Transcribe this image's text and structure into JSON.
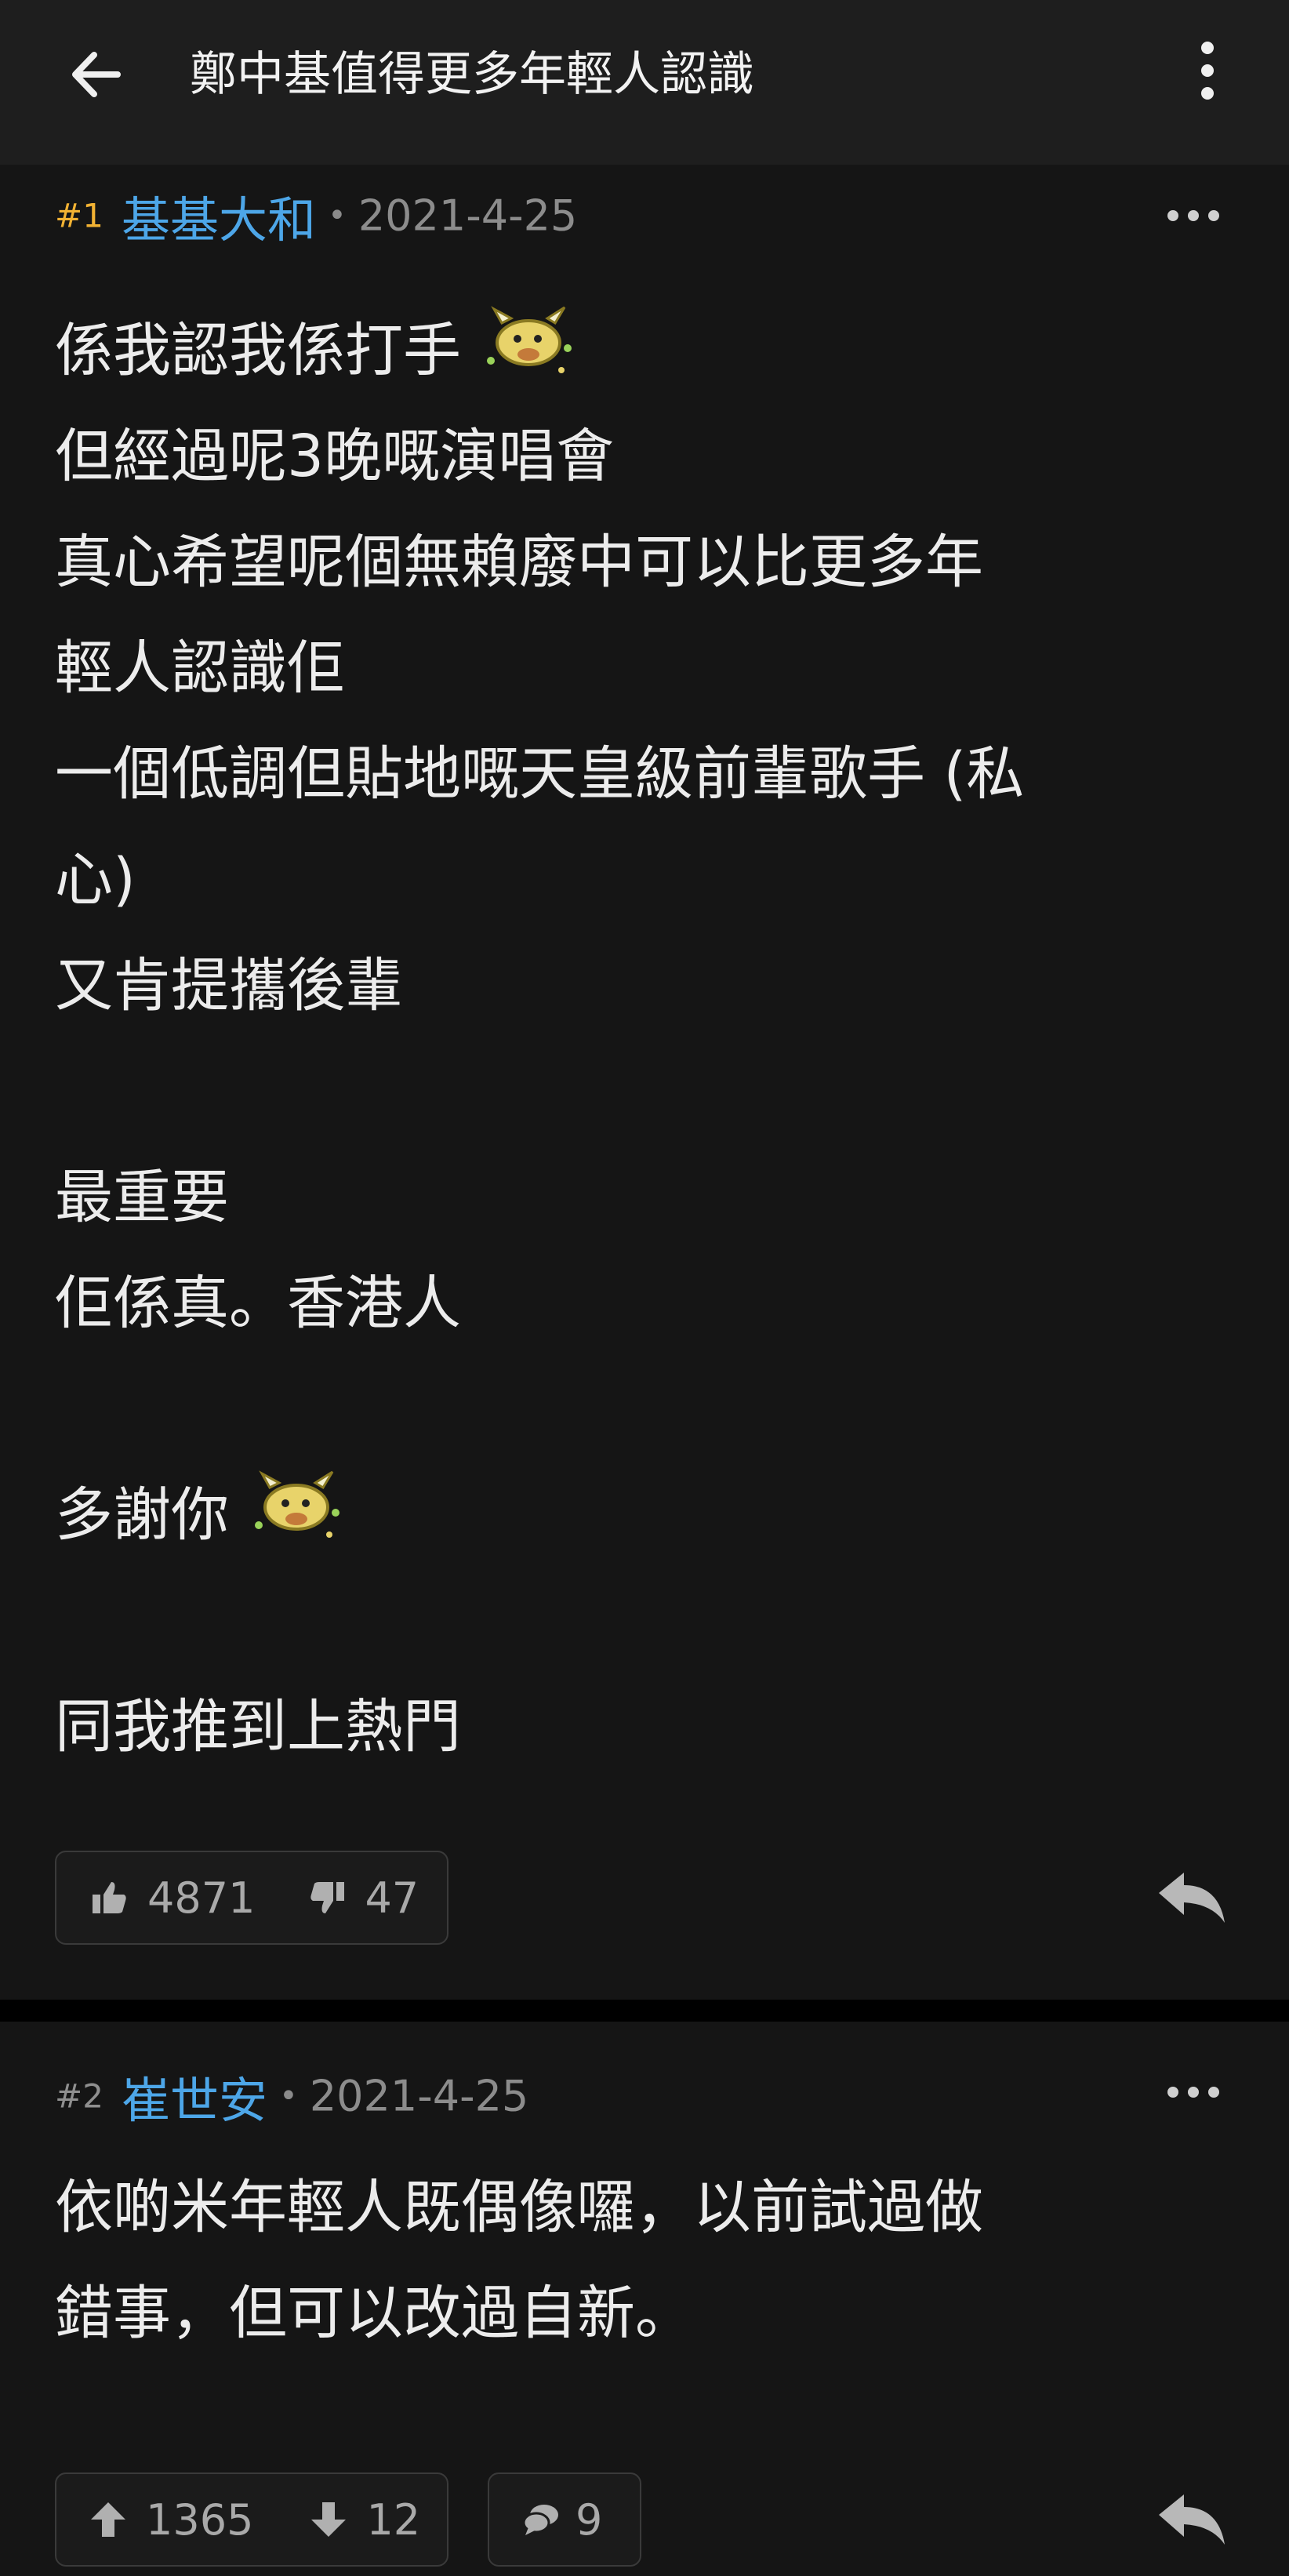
{
  "header": {
    "title": "鄭中基值得更多年輕人認識"
  },
  "posts": [
    {
      "floor": "#1",
      "author": "基基大和",
      "separator": "•",
      "date": "2021-4-25",
      "lines": [
        "係我認我係打手",
        "但經過呢3晚嘅演唱會",
        "真心希望呢個無賴廢中可以比更多年",
        "輕人認識佢",
        "一個低調但貼地嘅天皇級前輩歌手 (私",
        "心)",
        "又肯提攜後輩",
        "",
        "最重要",
        "佢係真。香港人",
        "",
        "多謝你",
        "",
        "同我推到上熱門"
      ],
      "likes": "4871",
      "dislikes": "47"
    },
    {
      "floor": "#2",
      "author": "崔世安",
      "separator": "•",
      "date": "2021-4-25",
      "lines": [
        "依啲米年輕人既偶像囉，以前試過做",
        "錯事，但可以改過自新。"
      ],
      "upvotes": "1365",
      "downvotes": "12",
      "comments": "9"
    }
  ],
  "icons": {
    "back": "arrow-left-icon",
    "more": "more-vertical-icon",
    "post_menu": "more-horizontal-icon",
    "like": "thumbs-up-icon",
    "dislike": "thumbs-down-icon",
    "upvote": "arrow-up-icon",
    "downvote": "arrow-down-icon",
    "comment": "comment-bubble-icon",
    "reply": "reply-icon",
    "emoji": "cow-emoji-icon"
  },
  "colors": {
    "background": "#151515",
    "topbar": "#1e1e1e",
    "author": "#4da6e8",
    "floor_highlight": "#f2b233",
    "meta": "#8c8c8c"
  }
}
